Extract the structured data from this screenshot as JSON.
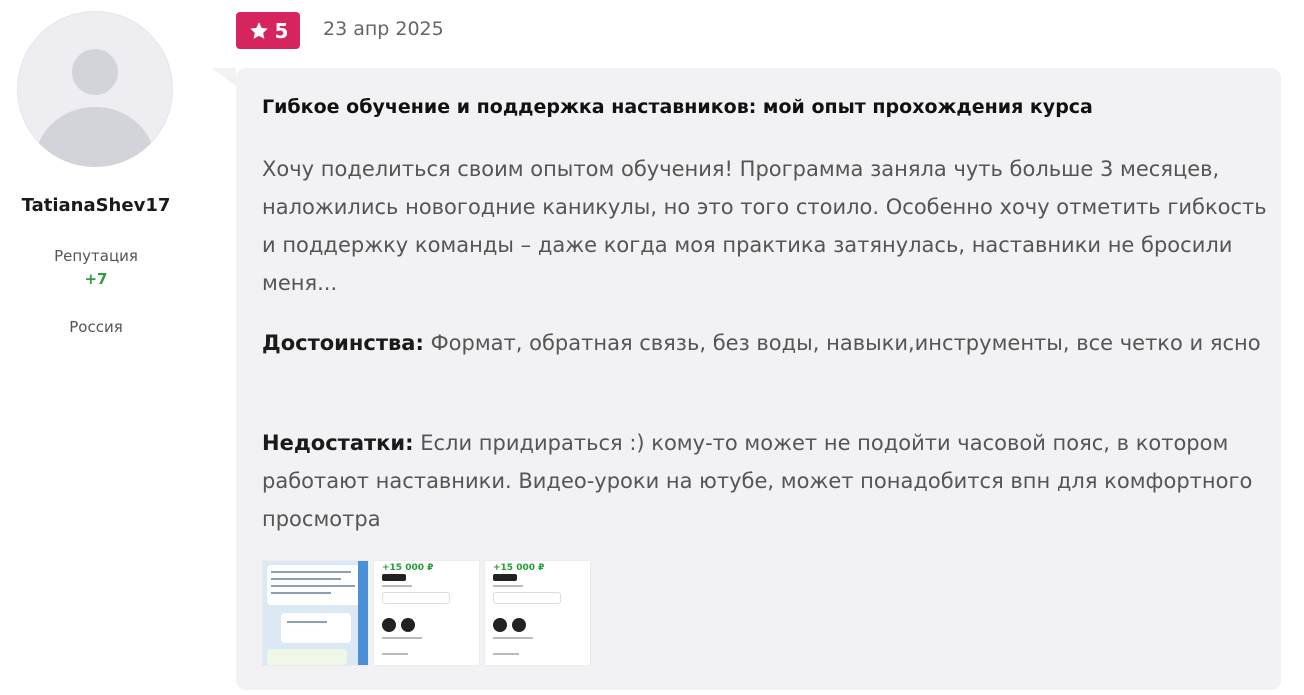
{
  "author": {
    "username": "TatianaShev17",
    "reputation_label": "Репутация",
    "reputation_value": "+7",
    "country": "Россия"
  },
  "review": {
    "rating": "5",
    "date": "23 апр 2025",
    "title": "Гибкое обучение и поддержка наставников: мой опыт прохождения курса",
    "body": "Хочу поделиться своим опытом обучения! Программа заняла чуть больше 3 месяцев, наложились новогодние каникулы, но это того стоило. Особенно хочу отметить гибкость и поддержку команды – даже когда моя практика затянулась, наставники не бросили меня...",
    "pros_label": "Достоинства:",
    "pros_text": " Формат, обратная связь, без воды, навыки,инструменты, все четко и ясно",
    "cons_label": "Недостатки:",
    "cons_text": " Если придираться :) кому-то может не подойти часовой пояс, в котором работают наставники. Видео-уроки на ютубе, может понадобится впн для комфортного просмотра"
  },
  "attachments": [
    {
      "kind": "chat-screenshot"
    },
    {
      "kind": "payment-screenshot",
      "amount": "+15 000 ₽"
    },
    {
      "kind": "payment-screenshot",
      "amount": "+15 000 ₽"
    }
  ],
  "colors": {
    "rating_badge": "#d6245c",
    "reputation_positive": "#2ea043",
    "bubble_background": "#f2f2f5"
  }
}
